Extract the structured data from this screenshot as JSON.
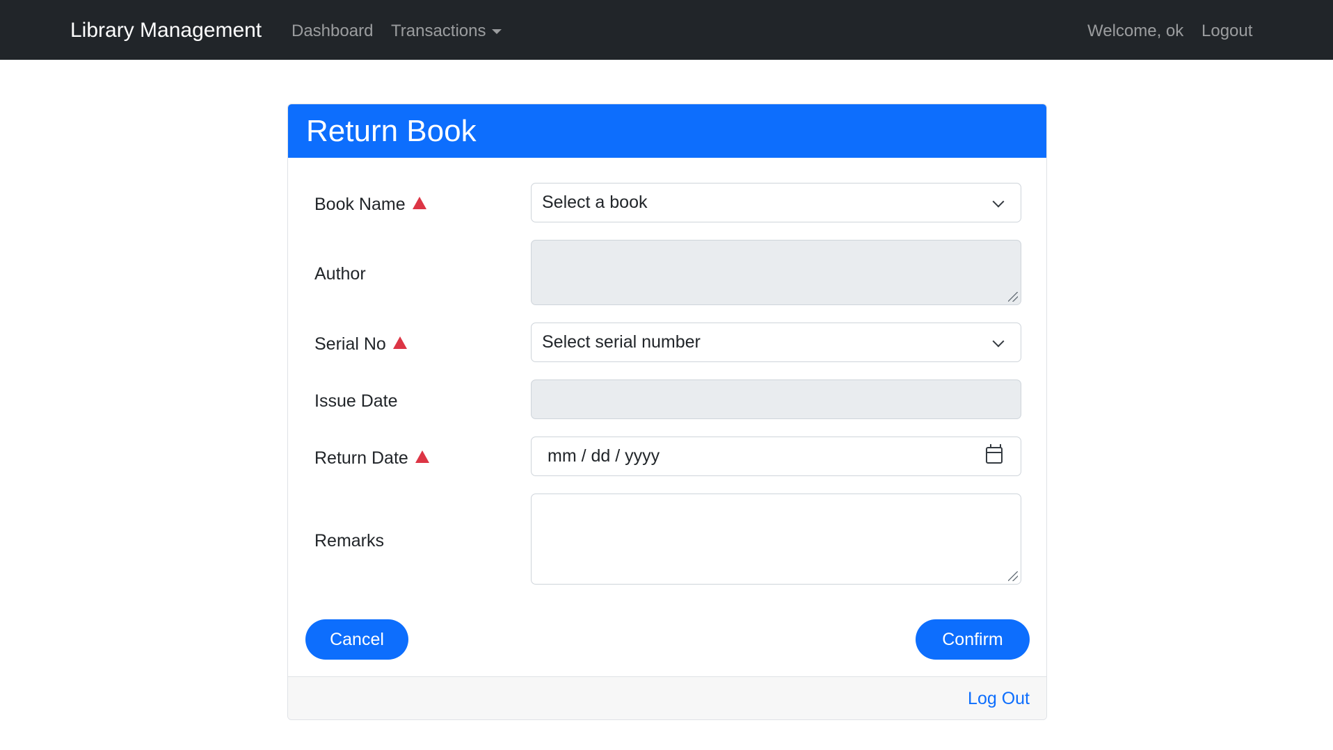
{
  "navbar": {
    "brand": "Library Management",
    "links": {
      "dashboard": "Dashboard",
      "transactions": "Transactions"
    },
    "welcome": "Welcome, ok",
    "logout": "Logout"
  },
  "card": {
    "title": "Return Book",
    "fields": {
      "book_name": {
        "label": "Book Name",
        "value": "Select a book",
        "required": true
      },
      "author": {
        "label": "Author",
        "value": "",
        "disabled": true
      },
      "serial_no": {
        "label": "Serial No",
        "value": "Select serial number",
        "required": true
      },
      "issue_date": {
        "label": "Issue Date",
        "value": "",
        "disabled": true
      },
      "return_date": {
        "label": "Return Date",
        "placeholder": "mm / dd / yyyy",
        "required": true
      },
      "remarks": {
        "label": "Remarks",
        "value": ""
      }
    },
    "buttons": {
      "cancel": "Cancel",
      "confirm": "Confirm"
    },
    "footer_link": "Log Out"
  },
  "colors": {
    "navbar_bg": "#212529",
    "primary": "#0d6efd",
    "required": "#dc3545",
    "disabled_bg": "#e9ecef"
  }
}
